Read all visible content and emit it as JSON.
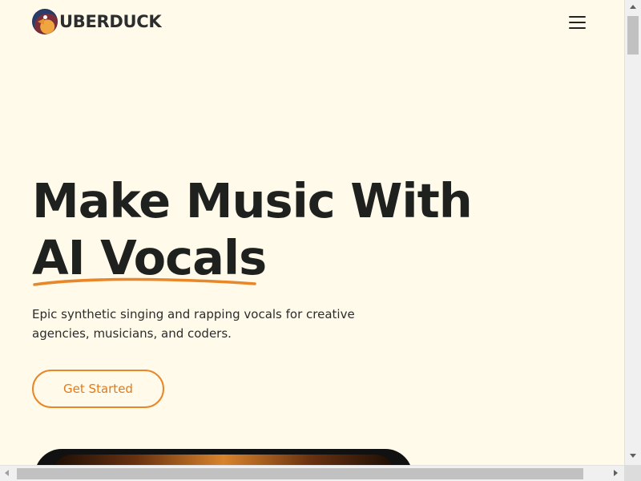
{
  "header": {
    "logo_text": "UBERDUCK",
    "logo_icon": "duck-logo-icon",
    "menu_icon": "hamburger-menu-icon"
  },
  "hero": {
    "title_line1": "Make Music With",
    "title_line2": "AI Vocals",
    "subtitle": "Epic synthetic singing and rapping vocals for creative agencies, musicians, and coders.",
    "cta_label": "Get Started"
  },
  "colors": {
    "background": "#fffaea",
    "accent": "#e8862a",
    "text": "#1e211e"
  }
}
